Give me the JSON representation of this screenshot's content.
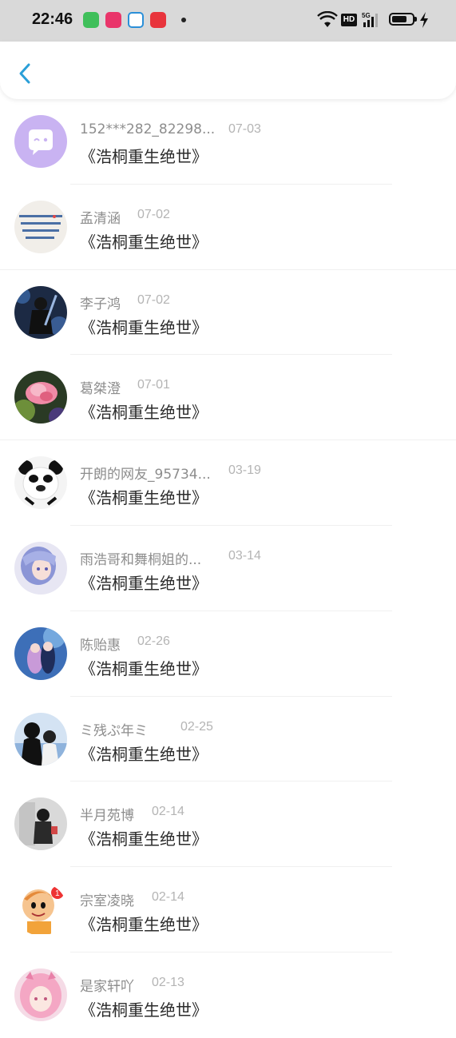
{
  "status_bar": {
    "time": "22:46",
    "hd_label": "HD",
    "signal_label": "5G",
    "app_icon_colors": [
      "#3fbf5a",
      "#e9356a",
      "#2a8fd8",
      "#e8343c"
    ]
  },
  "header": {
    "back_icon": "chevron-left-icon",
    "accent_color": "#2a9fd8"
  },
  "items": [
    {
      "name": "152***282_82298...",
      "date": "07-03",
      "title": "《浩桐重生绝世》",
      "avatar": "chat-bubble-avatar"
    },
    {
      "name": "孟清涵",
      "date": "07-02",
      "title": "《浩桐重生绝世》",
      "avatar": "text-note-avatar"
    },
    {
      "name": "李子鸿",
      "date": "07-02",
      "title": "《浩桐重生绝世》",
      "avatar": "anime-swordsman-avatar"
    },
    {
      "name": "葛桀澄",
      "date": "07-01",
      "title": "《浩桐重生绝世》",
      "avatar": "pink-flower-avatar"
    },
    {
      "name": "开朗的网友_95734...",
      "date": "03-19",
      "title": "《浩桐重生绝世》",
      "avatar": "panda-meme-avatar"
    },
    {
      "name": "雨浩哥和舞桐姐的...",
      "date": "03-14",
      "title": "《浩桐重生绝世》",
      "avatar": "anime-girl-avatar"
    },
    {
      "name": "陈贻惠",
      "date": "02-26",
      "title": "《浩桐重生绝世》",
      "avatar": "anime-couple-avatar"
    },
    {
      "name": "ミ残ぷ年ミ",
      "date": "02-25",
      "title": "《浩桐重生绝世》",
      "avatar": "silhouette-couple-avatar"
    },
    {
      "name": "半月苑博",
      "date": "02-14",
      "title": "《浩桐重生绝世》",
      "avatar": "girl-photo-avatar"
    },
    {
      "name": "宗室凌晓",
      "date": "02-14",
      "title": "《浩桐重生绝世》",
      "avatar": "cartoon-boy-avatar"
    },
    {
      "name": "是家轩吖",
      "date": "02-13",
      "title": "《浩桐重生绝世》",
      "avatar": "pink-hair-girl-avatar"
    }
  ]
}
